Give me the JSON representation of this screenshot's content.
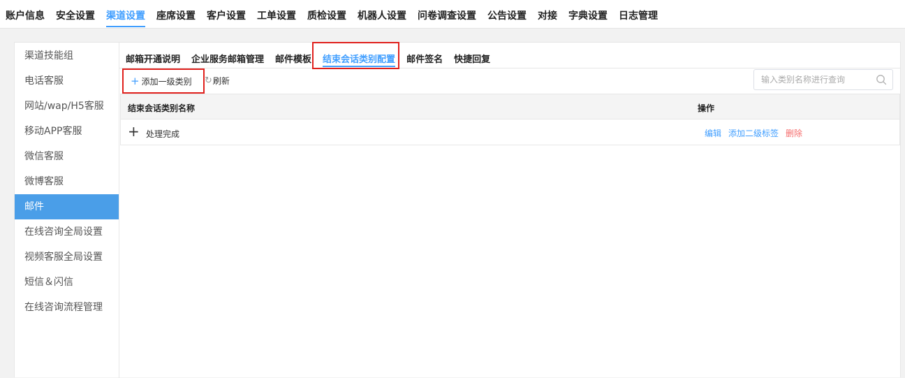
{
  "topnav": {
    "items": [
      "账户信息",
      "安全设置",
      "渠道设置",
      "座席设置",
      "客户设置",
      "工单设置",
      "质检设置",
      "机器人设置",
      "问卷调查设置",
      "公告设置",
      "对接",
      "字典设置",
      "日志管理"
    ],
    "active_index": 2
  },
  "sidebar": {
    "items": [
      "渠道技能组",
      "电话客服",
      "网站/wap/H5客服",
      "移动APP客服",
      "微信客服",
      "微博客服",
      "邮件",
      "在线咨询全局设置",
      "视频客服全局设置",
      "短信＆闪信",
      "在线咨询流程管理"
    ],
    "active_index": 6
  },
  "tabs": {
    "items": [
      "邮箱开通说明",
      "企业服务邮箱管理",
      "邮件模板",
      "结束会话类别配置",
      "邮件签名",
      "快捷回复"
    ],
    "active_index": 3
  },
  "toolbar": {
    "add_label": "添加一级类别",
    "refresh_label": "刷新",
    "search_placeholder": "输入类别名称进行查询"
  },
  "table": {
    "headers": {
      "name": "结束会话类别名称",
      "ops": "操作"
    },
    "rows": [
      {
        "name": "处理完成",
        "ops": [
          "编辑",
          "添加二级标签",
          "删除"
        ]
      }
    ]
  },
  "colors": {
    "accent": "#409eff",
    "sidebar_active": "#4a9ee8",
    "highlight": "#e0201c",
    "danger": "#f56c6c"
  }
}
